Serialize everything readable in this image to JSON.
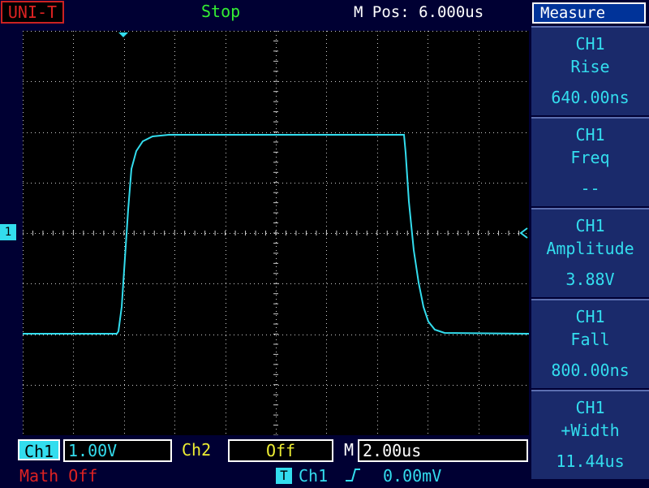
{
  "header": {
    "logo": "UNI-T",
    "run_state": "Stop",
    "m_pos": "M Pos: 6.000us",
    "menu_title": "Measure"
  },
  "waveform": {
    "channel_marker": "1",
    "color": "#33ddee",
    "grid_color": "#cccccc"
  },
  "measurements": [
    {
      "channel": "CH1",
      "name": "Rise",
      "value": "640.00ns"
    },
    {
      "channel": "CH1",
      "name": "Freq",
      "value": "--"
    },
    {
      "channel": "CH1",
      "name": "Amplitude",
      "value": "3.88V"
    },
    {
      "channel": "CH1",
      "name": "Fall",
      "value": "800.00ns"
    },
    {
      "channel": "CH1",
      "name": "+Width",
      "value": "11.44us"
    }
  ],
  "bottom": {
    "ch1_label": "Ch1",
    "ch1_scale": "1.00V",
    "ch2_label": "Ch2",
    "ch2_scale": "Off",
    "timebase_label": "M",
    "timebase": "2.00us",
    "math": "Math Off",
    "trigger_icon": "T",
    "trigger_source": "Ch1",
    "trigger_edge": "rising-edge-icon",
    "trigger_level": "0.00mV"
  }
}
